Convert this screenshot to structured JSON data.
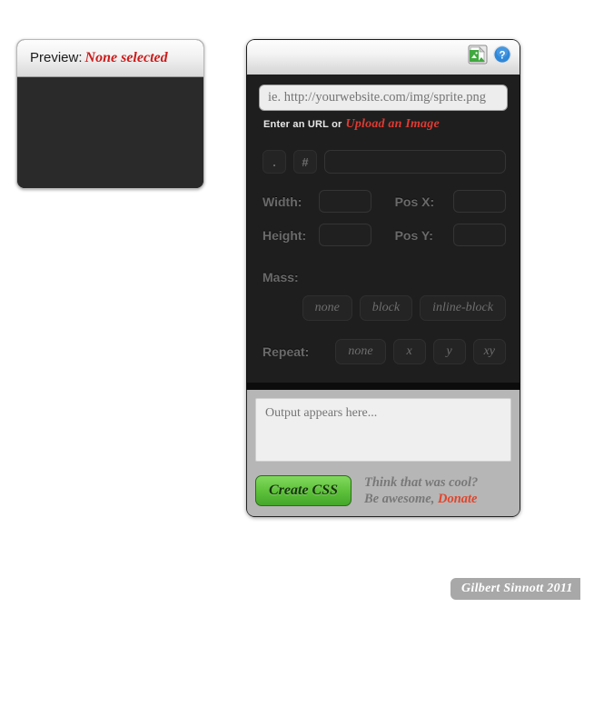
{
  "preview": {
    "label": "Preview:",
    "status": "None selected",
    "status_color": "#cc1c1c"
  },
  "header": {
    "image_icon": "image-icon",
    "help_icon": "help-icon"
  },
  "url": {
    "placeholder": "ie. http://yourwebsite.com/img/sprite.png",
    "value": "",
    "hint": "Enter an URL or",
    "upload_label": "Upload an Image",
    "upload_color": "#e03a32"
  },
  "selector": {
    "class_button": ".",
    "id_button": "#",
    "name_value": "",
    "name_placeholder": ""
  },
  "dimensions": {
    "width_label": "Width:",
    "width_value": "",
    "height_label": "Height:",
    "height_value": "",
    "posx_label": "Pos X:",
    "posx_value": "",
    "posy_label": "Pos Y:",
    "posy_value": ""
  },
  "mass": {
    "label": "Mass:",
    "options": [
      "none",
      "block",
      "inline-block"
    ]
  },
  "repeat": {
    "label": "Repeat:",
    "options": [
      "none",
      "x",
      "y",
      "xy"
    ]
  },
  "output": {
    "placeholder": "Output appears here...",
    "value": ""
  },
  "footer": {
    "create_label": "Create CSS",
    "create_color": "#5fc23c",
    "tagline_line1": "Think that was cool?",
    "tagline_line2": "Be awesome,",
    "donate_label": "Donate",
    "donate_color": "#e0452c"
  },
  "copyright": {
    "text": "Gilbert Sinnott 2011"
  }
}
